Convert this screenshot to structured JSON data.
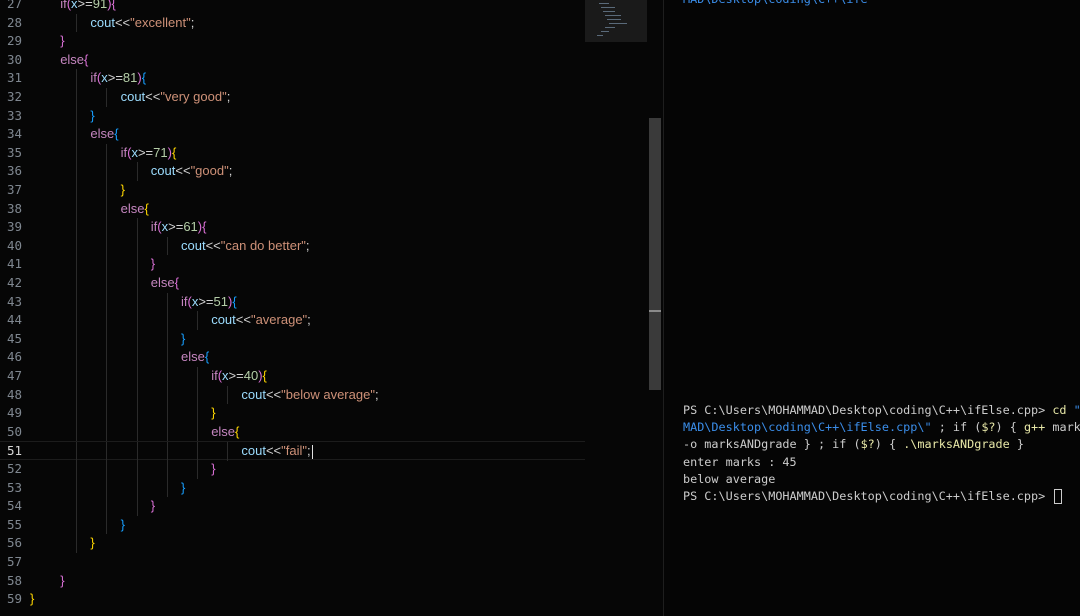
{
  "editor": {
    "lines": [
      {
        "n": "27",
        "text": "if(x>=91){"
      },
      {
        "n": "28",
        "text": "cout<<\"excellent\";"
      },
      {
        "n": "29",
        "text": "}"
      },
      {
        "n": "30",
        "text": "else{"
      },
      {
        "n": "31",
        "text": "if(x>=81){"
      },
      {
        "n": "32",
        "text": "cout<<\"very good\";"
      },
      {
        "n": "33",
        "text": "}"
      },
      {
        "n": "34",
        "text": "else{"
      },
      {
        "n": "35",
        "text": "if(x>=71){"
      },
      {
        "n": "36",
        "text": "cout<<\"good\";"
      },
      {
        "n": "37",
        "text": "}"
      },
      {
        "n": "38",
        "text": "else{"
      },
      {
        "n": "39",
        "text": "if(x>=61){"
      },
      {
        "n": "40",
        "text": "cout<<\"can do better\";"
      },
      {
        "n": "41",
        "text": "}"
      },
      {
        "n": "42",
        "text": "else{"
      },
      {
        "n": "43",
        "text": "if(x>=51){"
      },
      {
        "n": "44",
        "text": "cout<<\"average\";"
      },
      {
        "n": "45",
        "text": "}"
      },
      {
        "n": "46",
        "text": "else{"
      },
      {
        "n": "47",
        "text": "if(x>=40){"
      },
      {
        "n": "48",
        "text": "cout<<\"below average\";"
      },
      {
        "n": "49",
        "text": "}"
      },
      {
        "n": "50",
        "text": "else{"
      },
      {
        "n": "51",
        "text": "cout<<\"fail\";"
      },
      {
        "n": "52",
        "text": "}"
      },
      {
        "n": "53",
        "text": "}"
      },
      {
        "n": "54",
        "text": "}"
      },
      {
        "n": "55",
        "text": "}"
      },
      {
        "n": "56",
        "text": "}"
      },
      {
        "n": "57",
        "text": ""
      },
      {
        "n": "58",
        "text": "}"
      },
      {
        "n": "59",
        "text": "}"
      }
    ],
    "active_line": "51"
  },
  "terminal": {
    "top_fragment": "MAD\\Desktop\\coding\\C++\\ife",
    "prompt1_prefix": "PS C:\\Users\\MOHAMMAD\\Desktop\\coding\\C++\\ifElse.cpp> ",
    "prompt1_cmd": "cd",
    "prompt1_tail": " \"c",
    "line2_path": "MAD\\Desktop\\coding\\C++\\ifElse.cpp\\\"",
    "line2_rest_a": " ; if (",
    "line2_var": "$?",
    "line2_rest_b": ") { ",
    "line2_gpp": "g++",
    "line2_rest_c": " marks",
    "line3_a": "-o marksANDgrade } ; if (",
    "line3_var": "$?",
    "line3_b": ") { ",
    "line3_exe": ".\\marksANDgrade",
    "line3_c": " }",
    "output1": "enter marks : 45",
    "output2": "below average",
    "prompt2": "PS C:\\Users\\MOHAMMAD\\Desktop\\coding\\C++\\ifElse.cpp> "
  },
  "colors": {
    "background": "#050505",
    "keyword": "#c586c0",
    "string": "#ce9178",
    "number": "#b5cea8",
    "variable": "#9cdcfe",
    "bracket_level1": "#ffd700",
    "bracket_level2": "#da70d6",
    "bracket_level3": "#179fff",
    "terminal_path": "#3b8eea",
    "terminal_command": "#e8e8a8"
  }
}
